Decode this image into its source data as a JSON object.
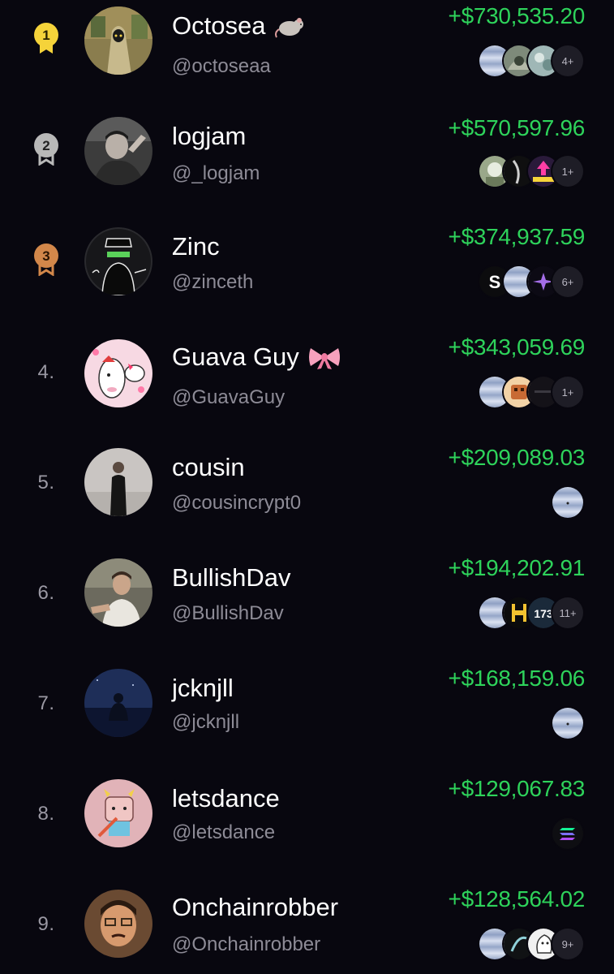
{
  "leaderboard": {
    "rows": [
      {
        "rank": "1",
        "name": "Octosea",
        "handle": "@octoseaa",
        "pnl": "+$730,535.20",
        "more": "4+"
      },
      {
        "rank": "2",
        "name": "logjam",
        "handle": "@_logjam",
        "pnl": "+$570,597.96",
        "more": "1+"
      },
      {
        "rank": "3",
        "name": "Zinc",
        "handle": "@zinceth",
        "pnl": "+$374,937.59",
        "more": "6+"
      },
      {
        "rank": "4.",
        "name": "Guava Guy",
        "handle": "@GuavaGuy",
        "pnl": "+$343,059.69",
        "more": "1+"
      },
      {
        "rank": "5.",
        "name": "cousin",
        "handle": "@cousincrypt0",
        "pnl": "+$209,089.03",
        "more": ""
      },
      {
        "rank": "6.",
        "name": "BullishDav",
        "handle": "@BullishDav",
        "pnl": "+$194,202.91",
        "more": "11+"
      },
      {
        "rank": "7.",
        "name": "jcknjll",
        "handle": "@jcknjll",
        "pnl": "+$168,159.06",
        "more": ""
      },
      {
        "rank": "8.",
        "name": "letsdance",
        "handle": "@letsdance",
        "pnl": "+$129,067.83",
        "more": ""
      },
      {
        "rank": "9.",
        "name": "Onchainrobber",
        "handle": "@Onchainrobber",
        "pnl": "+$128,564.02",
        "more": "9+"
      }
    ]
  },
  "colors": {
    "background": "#08070f",
    "profit_green": "#2ed35b",
    "handle_gray": "#8d8b96",
    "gold": "#f5d33a",
    "silver": "#b8b8b8",
    "bronze": "#d2874a"
  },
  "icons": {
    "rank_1": "gold-medal-icon",
    "rank_2": "silver-medal-icon",
    "rank_3": "bronze-medal-icon",
    "name_emoji_1": "rat-emoji-icon",
    "name_emoji_4": "ribbon-bow-emoji-icon"
  }
}
